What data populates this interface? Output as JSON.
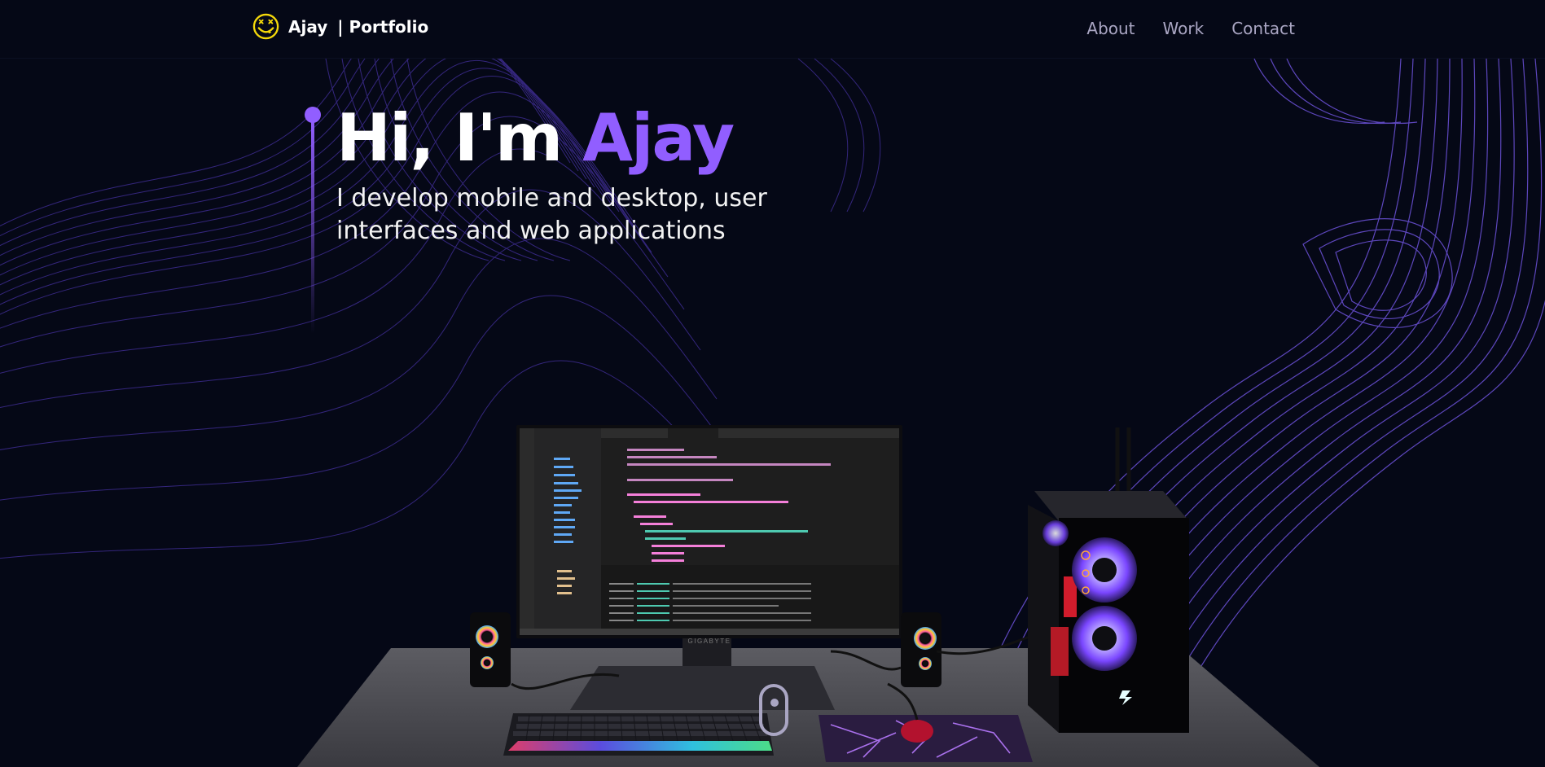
{
  "nav": {
    "brand_name": "Ajay",
    "brand_suffix": "| Portfolio",
    "links": [
      "About",
      "Work",
      "Contact"
    ]
  },
  "hero": {
    "greeting": "Hi, I'm ",
    "name": "Ajay",
    "subtitle": "I develop mobile and desktop, user interfaces and web applications"
  },
  "monitor": {
    "brand": "GIGABYTE"
  },
  "colors": {
    "background": "#050816",
    "accent": "#915eff",
    "nav_text": "#aaa6c3",
    "logo_yellow": "#f5d90a"
  },
  "icons": {
    "logo": "smiley-logo-icon",
    "scroll": "scroll-mouse-icon"
  }
}
